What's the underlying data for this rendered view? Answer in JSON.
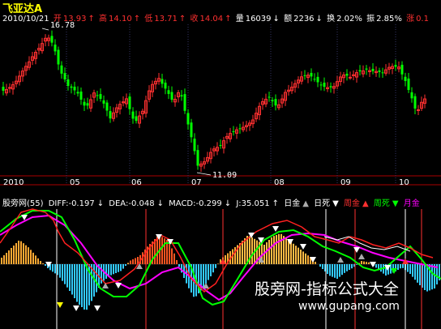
{
  "title": "飞亚达A",
  "quote": {
    "date": "2010/10/21",
    "open_label": "开",
    "open_value": "13.93",
    "high_label": "高",
    "high_value": "14.10",
    "low_label": "低",
    "low_value": "13.71",
    "close_label": "收",
    "close_value": "14.04",
    "volume_label": "量",
    "volume_value": "16039",
    "amount_label": "额",
    "amount_value": "2236",
    "turnover_label": "换",
    "turnover_value": "2.02%",
    "amplitude_label": "振",
    "amplitude_value": "2.85%",
    "change_label": "涨",
    "change_value": "0.1"
  },
  "price_chart": {
    "high_marker": "16.78",
    "low_marker": "11.09"
  },
  "months": [
    "2010",
    "05",
    "06",
    "07",
    "08",
    "09",
    "10"
  ],
  "indicator": {
    "name": "股旁网(55)",
    "diff": "DIFF:-0.197",
    "dea": "DEA:-0.048",
    "macd": "MACD:-0.299",
    "j": "J:35.051",
    "rijin": "日金",
    "risi": "日死",
    "zhoujin": "周金",
    "zhousi": "周死",
    "yuejin": "月金"
  },
  "watermark": {
    "text": "股旁网-指标公式大全",
    "url": "www.gupang.com"
  },
  "colors": {
    "up": "#ff3030",
    "down": "#00ff00",
    "diff_line": "#00ff00",
    "dea_line": "#ff00ff",
    "pos_bar": "#ffaa33",
    "neg_bar": "#00ccff"
  }
}
